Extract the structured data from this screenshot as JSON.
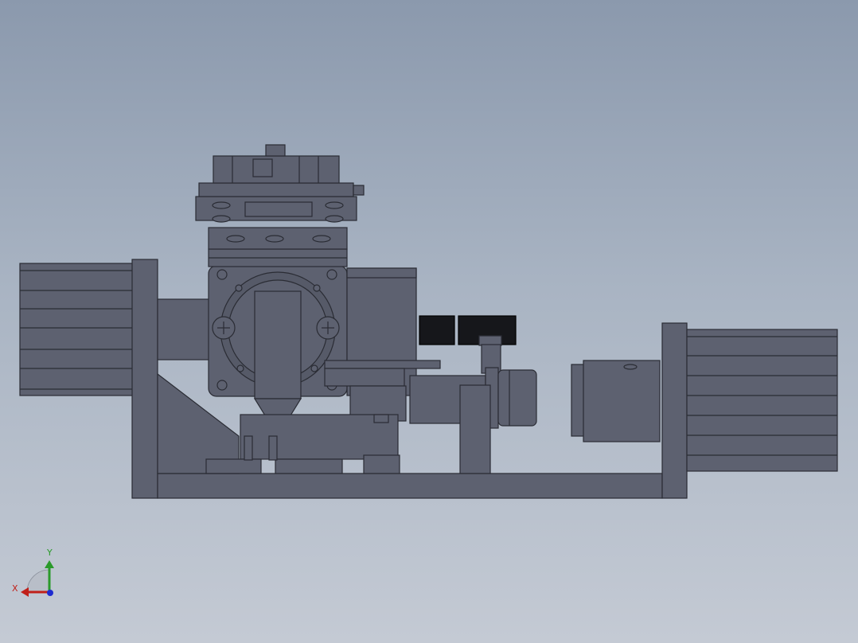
{
  "viewport": {
    "background_top": "#8b99ad",
    "background_bottom": "#c4cad4"
  },
  "model": {
    "body_color": "#5d6170",
    "edge_color": "#2a2c34",
    "dark_color": "#16171b",
    "highlight_color": "#7a7f8e"
  },
  "triad": {
    "x_label": "X",
    "y_label": "Y",
    "x_color": "#c0201a",
    "y_color": "#2a9a2a",
    "z_color": "#1d2bd0"
  }
}
